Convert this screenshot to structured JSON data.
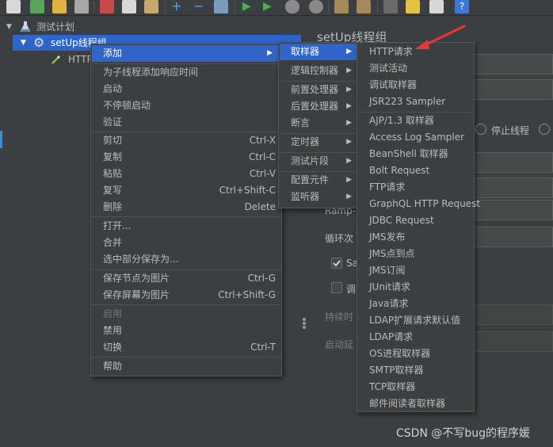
{
  "tree": {
    "plan_label": "测试计划",
    "setup_group_label": "setUp线程组",
    "http_child_label": "HTTP"
  },
  "panel": {
    "title": "setUp线程组",
    "stop_thread_label": "停止线程",
    "ramp_label": "Ramp-",
    "loop_label": "循环次",
    "same_user_label": "Sa",
    "delay_label": "调",
    "duration_label": "持续时",
    "startup_delay_label": "启动延"
  },
  "context_menu": {
    "items": [
      {
        "label": "添加",
        "submenu": true
      },
      {
        "label": "为子线程添加响应时间"
      },
      {
        "label": "启动"
      },
      {
        "label": "不停顿启动"
      },
      {
        "label": "验证"
      },
      {
        "label": "剪切",
        "shortcut": "Ctrl-X"
      },
      {
        "label": "复制",
        "shortcut": "Ctrl-C"
      },
      {
        "label": "粘贴",
        "shortcut": "Ctrl-V"
      },
      {
        "label": "复写",
        "shortcut": "Ctrl+Shift-C"
      },
      {
        "label": "删除",
        "shortcut": "Delete"
      },
      {
        "label": "打开..."
      },
      {
        "label": "合并"
      },
      {
        "label": "选中部分保存为..."
      },
      {
        "label": "保存节点为图片",
        "shortcut": "Ctrl-G"
      },
      {
        "label": "保存屏幕为图片",
        "shortcut": "Ctrl+Shift-G"
      },
      {
        "label": "启用"
      },
      {
        "label": "禁用"
      },
      {
        "label": "切换",
        "shortcut": "Ctrl-T"
      },
      {
        "label": "帮助"
      }
    ]
  },
  "add_submenu": {
    "items": [
      {
        "label": "取样器"
      },
      {
        "label": "逻辑控制器"
      },
      {
        "label": "前置处理器"
      },
      {
        "label": "后置处理器"
      },
      {
        "label": "断言"
      },
      {
        "label": "定时器"
      },
      {
        "label": "测试片段"
      },
      {
        "label": "配置元件"
      },
      {
        "label": "监听器"
      }
    ]
  },
  "sampler_submenu": {
    "items": [
      {
        "label": "HTTP请求"
      },
      {
        "label": "测试活动"
      },
      {
        "label": "调试取样器"
      },
      {
        "label": "JSR223 Sampler"
      },
      {
        "label": "AJP/1.3 取样器"
      },
      {
        "label": "Access Log Sampler"
      },
      {
        "label": "BeanShell 取样器"
      },
      {
        "label": "Bolt Request"
      },
      {
        "label": "FTP请求"
      },
      {
        "label": "GraphQL HTTP Request"
      },
      {
        "label": "JDBC Request"
      },
      {
        "label": "JMS发布"
      },
      {
        "label": "JMS点到点"
      },
      {
        "label": "JMS订阅"
      },
      {
        "label": "JUnit请求"
      },
      {
        "label": "Java请求"
      },
      {
        "label": "LDAP扩展请求默认值"
      },
      {
        "label": "LDAP请求"
      },
      {
        "label": "OS进程取样器"
      },
      {
        "label": "SMTP取样器"
      },
      {
        "label": "TCP取样器"
      },
      {
        "label": "邮件阅读者取样器"
      }
    ]
  },
  "watermark": "CSDN @不写bug的程序媛",
  "colors": {
    "background": "#3c3f41",
    "highlight": "#2f65ca",
    "annotation_arrow": "#e53935"
  }
}
